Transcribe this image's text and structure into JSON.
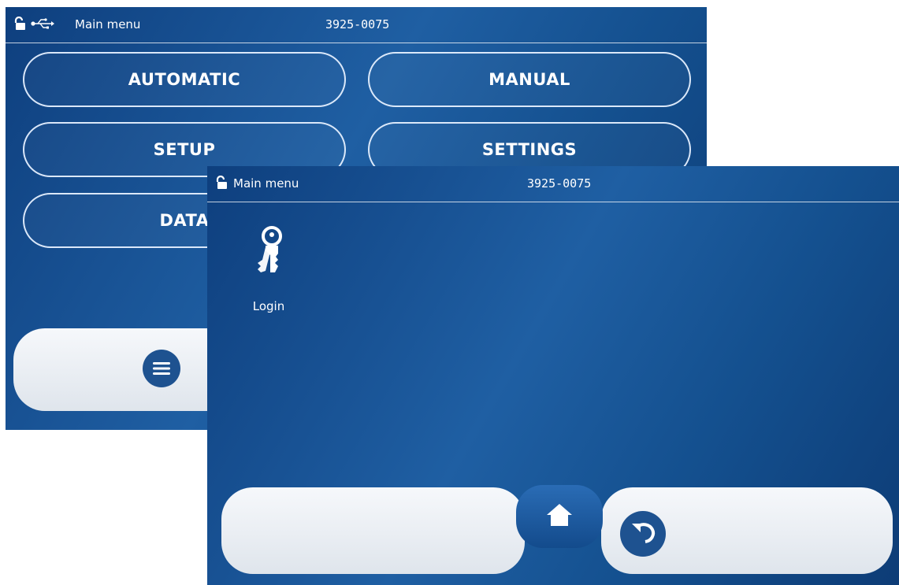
{
  "back_screen": {
    "status_bar": {
      "lock_icon": "unlocked-padlock-icon",
      "usb_icon": "usb-icon",
      "title": "Main menu",
      "serial": "3925-0075"
    },
    "menu_buttons": [
      {
        "label": "AUTOMATIC"
      },
      {
        "label": "MANUAL"
      },
      {
        "label": "SETUP"
      },
      {
        "label": "SETTINGS"
      },
      {
        "label": "DATA"
      }
    ],
    "bottom_bar": {
      "menu_icon": "hamburger-menu-icon"
    }
  },
  "front_screen": {
    "status_bar": {
      "lock_icon": "unlocked-padlock-icon",
      "title": "Main menu",
      "serial": "3925-0075"
    },
    "tiles": [
      {
        "label": "Login",
        "icon": "keys-icon"
      }
    ],
    "bottom_bar": {
      "home_icon": "home-icon",
      "back_icon": "undo-arrow-icon"
    }
  },
  "colors": {
    "screen_blue": "#1a5598",
    "icon_blue": "#1e5290",
    "pill_grey": "#e6ebf1",
    "text_white": "#ffffff"
  }
}
